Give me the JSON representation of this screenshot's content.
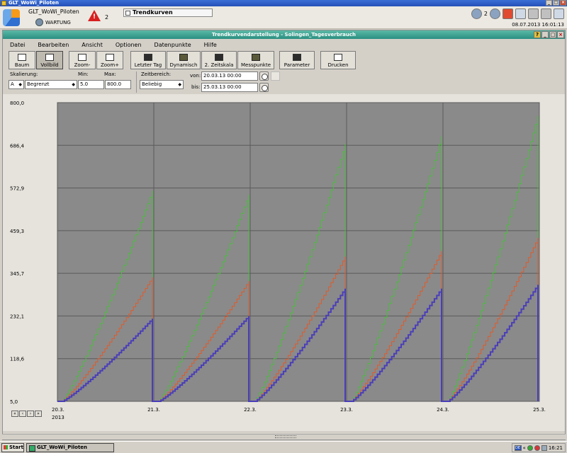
{
  "outer_window": {
    "title": "GLT_WoWi_Piloten"
  },
  "header": {
    "station_name": "GLT_WoWi_Piloten",
    "mode": "WARTUNG",
    "alarm_count": "2",
    "active_app": "Trendkurven",
    "user_count": "2",
    "datetime": "08.07.2013 16:01:13"
  },
  "inner_window": {
    "title": "Trendkurvendarstellung - Solingen_Tagesverbrauch"
  },
  "menu": [
    "Datei",
    "Bearbeiten",
    "Ansicht",
    "Optionen",
    "Datenpunkte",
    "Hilfe"
  ],
  "toolbar": {
    "baum": "Baum",
    "vollbild": "Vollbild",
    "zoom_minus": "Zoom-",
    "zoom_plus": "Zoom+",
    "letzter_tag": "Letzter Tag",
    "dynamisch": "Dynamisch",
    "zeitskala": "2. Zeitskala",
    "messpunkte": "Messpunkte",
    "parameter": "Parameter",
    "drucken": "Drucken"
  },
  "scaling": {
    "label": "Skalierung:",
    "axis": "A",
    "mode": "Begrenzt",
    "min_label": "Min:",
    "min_value": "5.0",
    "max_label": "Max:",
    "max_value": "800.0"
  },
  "timerange": {
    "label": "Zeitbereich:",
    "mode": "Beliebig",
    "from_label": "von:",
    "from_value": "20.03.13 00:00",
    "to_label": "bis:",
    "to_value": "25.03.13 00:00"
  },
  "chart_data": {
    "type": "line",
    "ylim": [
      5.0,
      800.0
    ],
    "yticks": [
      "800,0",
      "686,4",
      "572,9",
      "459,3",
      "345,7",
      "232,1",
      "118,6",
      "5,0"
    ],
    "xticks": [
      "20.3.",
      "21.3.",
      "22.3.",
      "23.3.",
      "24.3.",
      "25.3."
    ],
    "x_year": "2013",
    "cursor_at": "22.5",
    "grid": true,
    "colors": {
      "plot_bg": "#8a8a8a",
      "grid": "#5a5a5a",
      "green": "#4bbd3f",
      "orange": "#e05a2a",
      "purple": "#4a3eb8"
    },
    "series": [
      {
        "color": "green",
        "days": [
          {
            "start": 5.0,
            "end": 565.0
          },
          {
            "start": 5.0,
            "end": 555.0
          },
          {
            "start": 5.0,
            "end": 690.0
          },
          {
            "start": 5.0,
            "end": 710.0
          },
          {
            "start": 5.0,
            "end": 765.0
          }
        ]
      },
      {
        "color": "orange",
        "days": [
          {
            "start": 5.0,
            "end": 335.0
          },
          {
            "start": 5.0,
            "end": 325.0
          },
          {
            "start": 5.0,
            "end": 390.0
          },
          {
            "start": 5.0,
            "end": 405.0
          },
          {
            "start": 5.0,
            "end": 440.0
          }
        ]
      },
      {
        "color": "purple",
        "days": [
          {
            "start": 5.0,
            "end": 225.0
          },
          {
            "start": 5.0,
            "end": 232.0
          },
          {
            "start": 5.0,
            "end": 305.0
          },
          {
            "start": 5.0,
            "end": 305.0
          },
          {
            "start": 5.0,
            "end": 315.0
          }
        ]
      }
    ]
  },
  "taskbar": {
    "start": "Start",
    "task": "GLT_WoWi_Piloten",
    "lang": "DE",
    "clock": "16:21"
  }
}
